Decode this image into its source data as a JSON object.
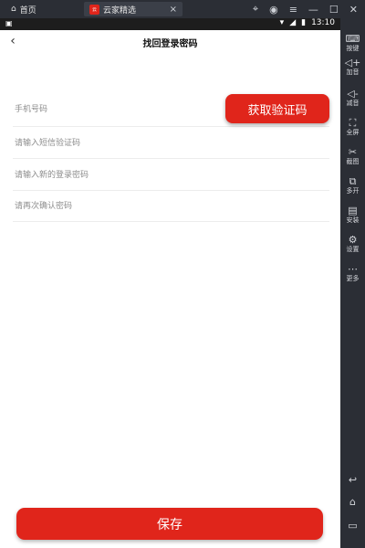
{
  "emulator": {
    "tabs": [
      {
        "label": "首页"
      },
      {
        "label": "云家精选",
        "badge": "云"
      }
    ],
    "tab_close": "×",
    "top_icons": [
      "gamepad-icon",
      "user-icon",
      "menu-icon",
      "minimize-icon",
      "maximize-icon",
      "close-icon"
    ],
    "sidebar": [
      {
        "label": "按键",
        "icon": "keyboard-icon"
      },
      {
        "label": "加音",
        "icon": "volume-up-icon"
      },
      {
        "label": "减音",
        "icon": "volume-down-icon"
      },
      {
        "label": "全屏",
        "icon": "fullscreen-icon"
      },
      {
        "label": "截图",
        "icon": "scissors-icon"
      },
      {
        "label": "多开",
        "icon": "multi-instance-icon"
      },
      {
        "label": "安装",
        "icon": "apk-install-icon"
      },
      {
        "label": "设置",
        "icon": "gear-icon"
      },
      {
        "label": "更多",
        "icon": "more-icon"
      }
    ],
    "bottom_nav": [
      "back-icon",
      "home-icon",
      "recent-apps-icon"
    ]
  },
  "status_bar": {
    "time": "13:10",
    "indicators": [
      "wifi-icon",
      "signal-icon",
      "battery-icon"
    ]
  },
  "page": {
    "title": "找回登录密码",
    "back_icon": "chevron-left-icon"
  },
  "form": {
    "phone_placeholder": "手机号码",
    "get_code_label": "获取验证码",
    "sms_code_placeholder": "请输入短信验证码",
    "new_password_placeholder": "请输入新的登录密码",
    "confirm_password_placeholder": "请再次确认密码",
    "save_label": "保存"
  },
  "colors": {
    "accent": "#e0251b",
    "emulator_bg": "#2b2e35"
  }
}
